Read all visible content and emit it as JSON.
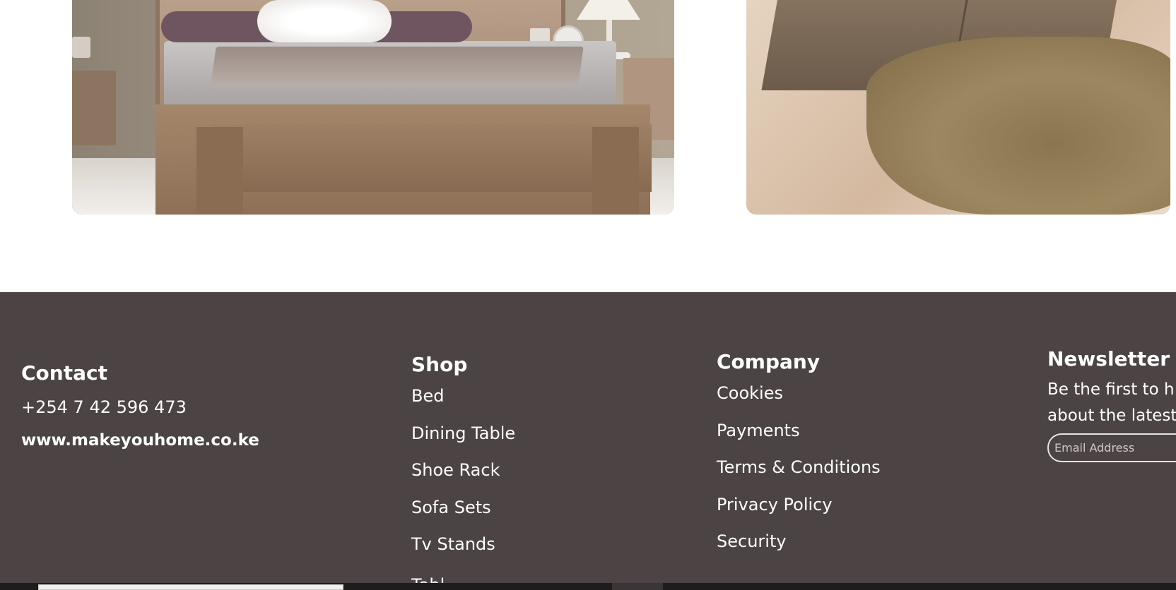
{
  "images": {
    "left_alt": "bedroom",
    "right_alt": "living-room"
  },
  "footer": {
    "contact": {
      "title": "Contact",
      "phone": "+254 7 42 596 473",
      "website": "www.makeyouhome.co.ke"
    },
    "shop": {
      "title": "Shop",
      "items": [
        "Bed",
        "Dining Table",
        "Shoe Rack",
        "Sofa Sets",
        "Tv Stands",
        "Tabl"
      ]
    },
    "company": {
      "title": "Company",
      "items": [
        "Cookies",
        "Payments",
        "Terms & Conditions",
        "Privacy Policy",
        "Security"
      ]
    },
    "newsletter": {
      "title": "Newsletter",
      "line1": "Be the first to h",
      "line2": "about the latest",
      "email_placeholder": "Email Address"
    }
  },
  "colors": {
    "footer_bg": "#4b4344",
    "footer_text": "#ffffff",
    "taskbar": "#1f1c1d"
  }
}
